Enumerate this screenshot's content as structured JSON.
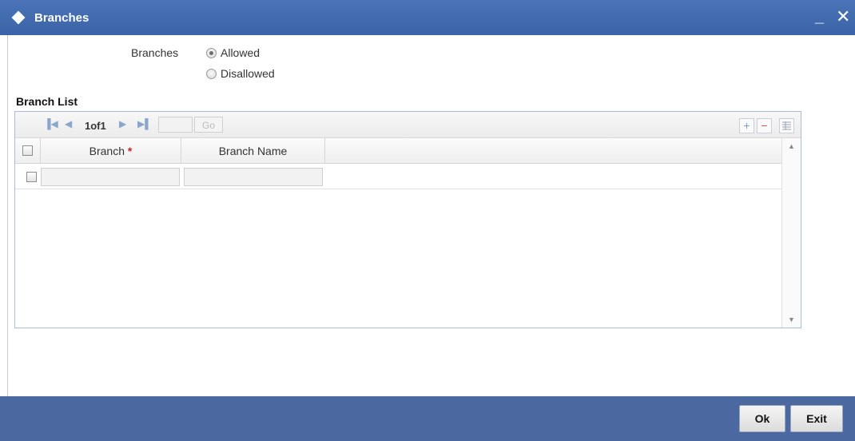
{
  "window": {
    "title": "Branches",
    "minimize": "_",
    "close": "✕"
  },
  "form": {
    "label": "Branches",
    "options": [
      {
        "label": "Allowed",
        "checked": true
      },
      {
        "label": "Disallowed",
        "checked": false
      }
    ]
  },
  "branch_list": {
    "title": "Branch List",
    "pager": {
      "page_text": "1of1",
      "go_label": "Go"
    },
    "columns": [
      {
        "label": "Branch",
        "required": true,
        "required_mark": "*"
      },
      {
        "label": "Branch Name",
        "required": false
      }
    ],
    "rows": [
      {
        "branch": "",
        "branch_name": ""
      }
    ]
  },
  "footer": {
    "ok_label": "Ok",
    "exit_label": "Exit"
  }
}
